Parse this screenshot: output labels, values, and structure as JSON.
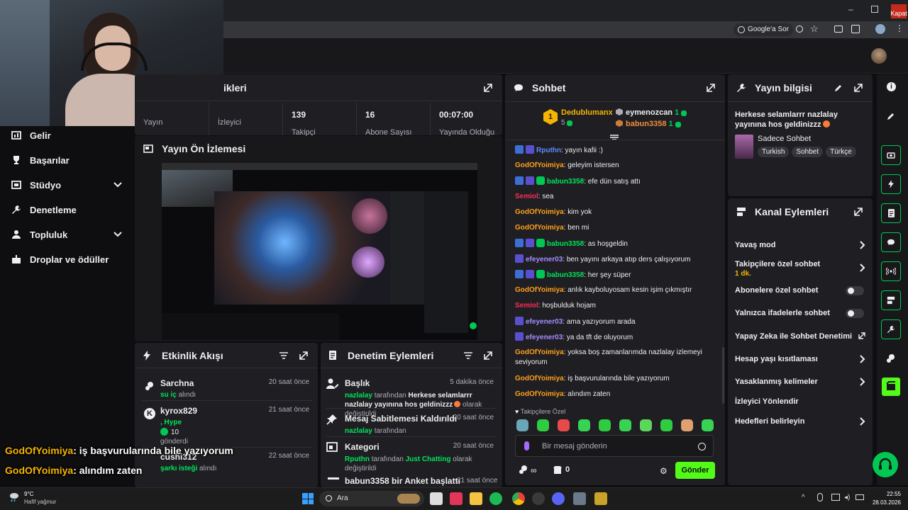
{
  "browser": {
    "close_tooltip": "Kapat",
    "google_search_label": "Google'a Sor"
  },
  "sidebar": {
    "items": [
      {
        "label": "Gelir",
        "icon": "revenue-icon"
      },
      {
        "label": "Başarılar",
        "icon": "trophy-icon"
      },
      {
        "label": "Stüdyo",
        "icon": "studio-icon"
      },
      {
        "label": "Denetleme",
        "icon": "wrench-icon"
      },
      {
        "label": "Topluluk",
        "icon": "community-icon"
      },
      {
        "label": "Droplar ve ödüller",
        "icon": "drops-icon"
      }
    ]
  },
  "stats_panel": {
    "title_fragment": "ikleri",
    "stats": [
      {
        "value": "",
        "label": "Yayın"
      },
      {
        "value": "",
        "label": "İzleyici"
      },
      {
        "value": "139",
        "label": "Takipçi"
      },
      {
        "value": "16",
        "label": "Abone Sayısı"
      },
      {
        "value": "00:07:00",
        "label": "Yayında Olduğu"
      }
    ]
  },
  "preview_panel": {
    "title": "Yayın Ön İzlemesi"
  },
  "activity_panel": {
    "title": "Etkinlik Akışı",
    "items": [
      {
        "name": "Sarchna",
        "time": "20 saat önce",
        "highlight": "su iç",
        "rest": " alındı"
      },
      {
        "name": "kyrox829",
        "time": "21 saat önce",
        "highlight": ", Hype",
        "count": "10",
        "rest": "gönderdi"
      },
      {
        "name": "cushi312",
        "time": "22 saat önce",
        "highlight": "şarkı isteği",
        "rest": " alındı"
      }
    ]
  },
  "mod_panel": {
    "title": "Denetim Eylemleri",
    "items": [
      {
        "title": "Başlık",
        "time": "5 dakika önce",
        "by": "nazlalay",
        "text1": " tarafından ",
        "value": "Herkese selamlarrr nazlalay yayınına hos geldinizzz",
        "text2": " olarak değiştirildi"
      },
      {
        "title": "Mesaj Sabitlemesi Kaldırıldı",
        "time": "20 saat önce",
        "by": "nazlalay",
        "text1": " tarafından"
      },
      {
        "title": "Kategori",
        "time": "20 saat önce",
        "by": "Rputhn",
        "text1": " tarafından ",
        "value": "Just Chatting",
        "text2": " olarak değiştirildi"
      },
      {
        "title": "babun3358 bir Anket başlattı",
        "time": "21 saat önce"
      }
    ]
  },
  "chat": {
    "title": "Sohbet",
    "leaderboard": [
      {
        "rank": "1",
        "name": "Dedublumanx",
        "points": "5"
      },
      {
        "name": "eymenozcan",
        "points": "1"
      },
      {
        "name": "babun3358",
        "points": "1"
      }
    ],
    "messages": [
      {
        "user": "Rputhn",
        "color": "#5b8cff",
        "text": ": yayın kafii :)",
        "badges": [
          "blue",
          "star"
        ]
      },
      {
        "user": "GodOfYoimiya",
        "color": "#ff9f1a",
        "text": ": geleyim istersen",
        "badges": []
      },
      {
        "user": "babun3358",
        "color": "#00e35b",
        "text": ": efe dün satış attı",
        "badges": [
          "blue",
          "star",
          "green"
        ]
      },
      {
        "user": "Semiol",
        "color": "#ff2b56",
        "text": ": sea",
        "badges": []
      },
      {
        "user": "GodOfYoimiya",
        "color": "#ff9f1a",
        "text": ": kim yok",
        "badges": []
      },
      {
        "user": "GodOfYoimiya",
        "color": "#ff9f1a",
        "text": ": ben mi",
        "badges": []
      },
      {
        "user": "babun3358",
        "color": "#00e35b",
        "text": ": as hoşgeldin",
        "badges": [
          "blue",
          "star",
          "green"
        ]
      },
      {
        "user": "efeyener03",
        "color": "#a58bff",
        "text": ": ben yayını arkaya atıp ders çalışıyorum",
        "badges": [
          "star"
        ]
      },
      {
        "user": "babun3358",
        "color": "#00e35b",
        "text": ": her şey süper",
        "badges": [
          "blue",
          "star",
          "green"
        ]
      },
      {
        "user": "GodOfYoimiya",
        "color": "#ff9f1a",
        "text": ": anlık kayboluyosam kesin işim çıkmıştır",
        "badges": []
      },
      {
        "user": "Semiol",
        "color": "#ff2b56",
        "text": ": hoşbulduk hojam",
        "badges": []
      },
      {
        "user": "efeyener03",
        "color": "#a58bff",
        "text": ": ama yazıyorum arada",
        "badges": [
          "star"
        ]
      },
      {
        "user": "efeyener03",
        "color": "#a58bff",
        "text": ": ya da tft de oluyorum",
        "badges": [
          "star"
        ]
      },
      {
        "user": "GodOfYoimiya",
        "color": "#ff9f1a",
        "text": ": yoksa boş zamanlarımda nazlalay izlemeyi seviyorum",
        "badges": []
      },
      {
        "user": "GodOfYoimiya",
        "color": "#ff9f1a",
        "text": ": iş başvurularında bile yazıyorum",
        "badges": []
      },
      {
        "user": "GodOfYoimiya",
        "color": "#ff9f1a",
        "text": ": alındım zaten",
        "badges": []
      }
    ],
    "followers_only_label": "Takipçilere Özel",
    "input_placeholder": "Bir mesaj gönderin",
    "points_value": "0",
    "send_label": "Gönder"
  },
  "stream_info": {
    "title": "Yayın bilgisi",
    "stream_title": "Herkese selamlarrr nazlalay yayınına hos geldinizzz",
    "category": "Sadece Sohbet",
    "tags": [
      "Turkish",
      "Sohbet",
      "Türkçe"
    ]
  },
  "channel_actions": {
    "title": "Kanal Eylemleri",
    "items": [
      {
        "label": "Yavaş mod",
        "control": "chevron"
      },
      {
        "label": "Takipçilere özel sohbet",
        "sub": "1 dk.",
        "control": "chevron"
      },
      {
        "label": "Abonelere özel sohbet",
        "control": "toggle"
      },
      {
        "label": "Yalnızca ifadelerle sohbet",
        "control": "toggle"
      },
      {
        "label": "Yapay Zeka ile Sohbet Denetimi",
        "control": "external"
      },
      {
        "label": "Hesap yaşı kısıtlaması",
        "control": "chevron"
      },
      {
        "label": "Yasaklanmış kelimeler",
        "control": "chevron"
      },
      {
        "label": "İzleyici Yönlendir",
        "control": "none"
      },
      {
        "label": "Hedefleri belirleyin",
        "control": "chevron"
      }
    ]
  },
  "overlay_chat": [
    {
      "user": "GodOfYoimiya",
      "text": ": iş başvurularında bile yazıyorum"
    },
    {
      "user": "GodOfYoimiya",
      "text": ": alındım zaten"
    }
  ],
  "taskbar": {
    "weather_temp": "9°C",
    "weather_desc": "Hafif yağmur",
    "search_label": "Ara",
    "time": "22:55",
    "date": "28.03.2026"
  }
}
